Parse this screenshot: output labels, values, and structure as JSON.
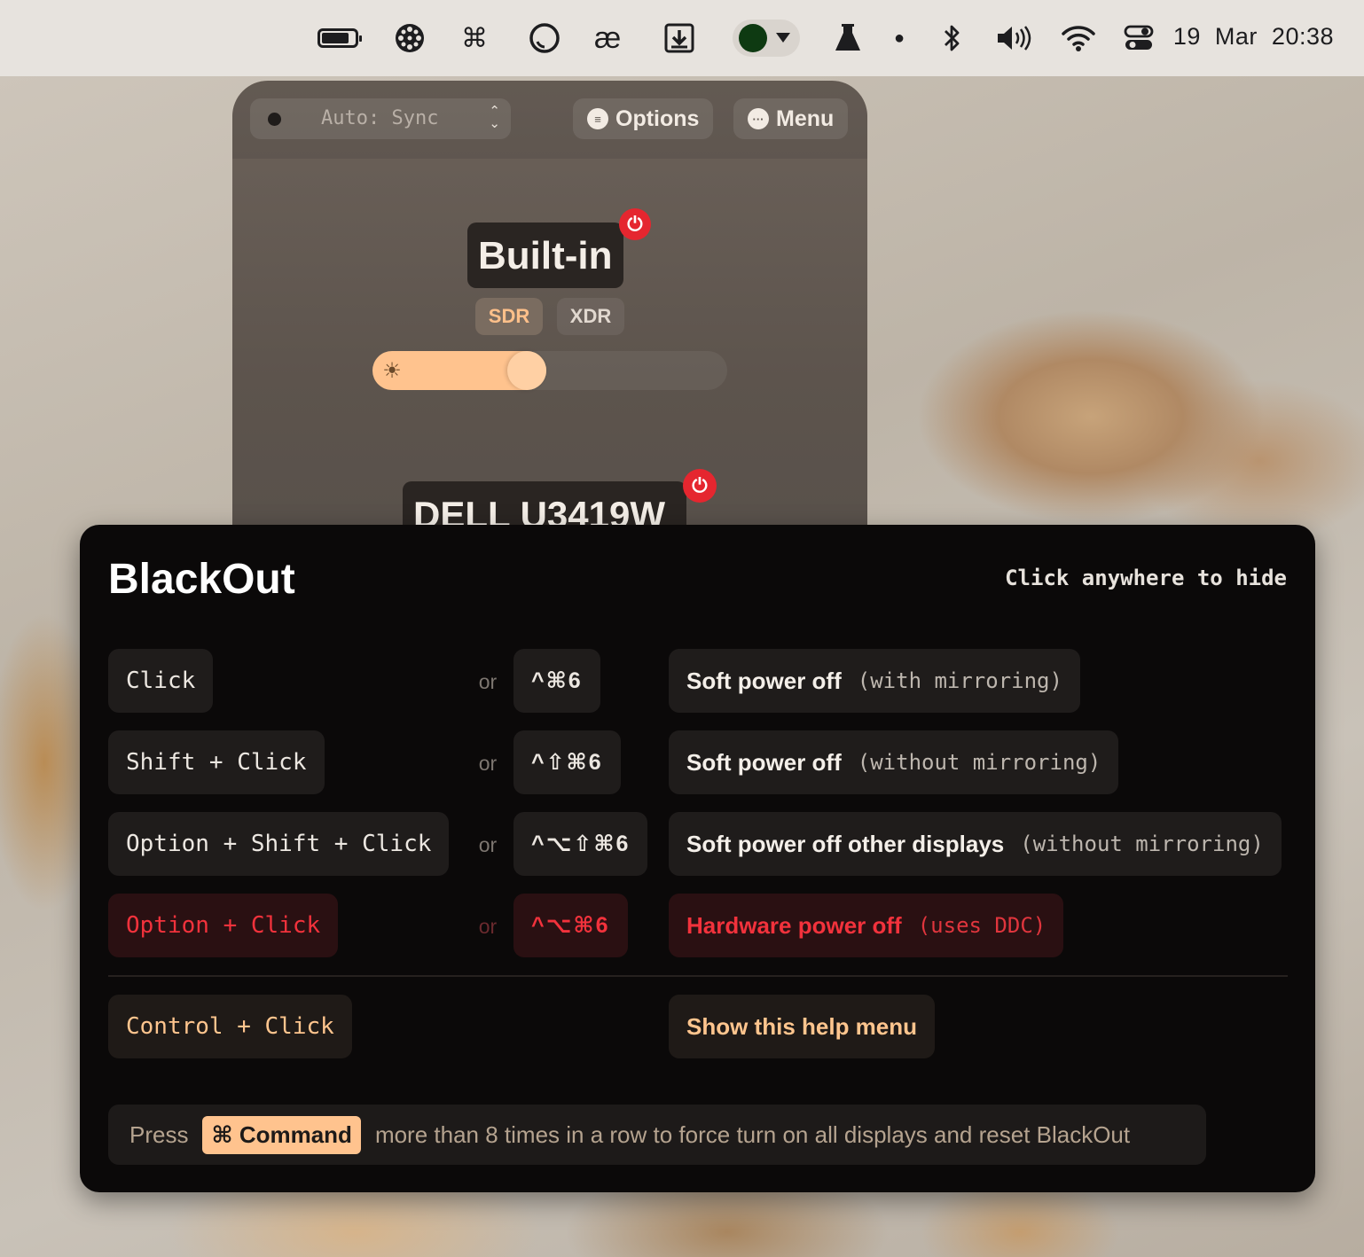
{
  "menubar": {
    "icons": [
      "battery-icon",
      "lunar-wheel-icon",
      "command-icon",
      "circle-icon",
      "ae-icon",
      "download-box-icon",
      "green-dot-dropdown-icon",
      "flask-icon",
      "dot-icon",
      "bluetooth-icon",
      "volume-icon",
      "wifi-icon",
      "control-center-icon"
    ],
    "date": "19 Mar",
    "time": "20:38"
  },
  "panel": {
    "mode_label": "Auto: Sync",
    "options_label": "Options",
    "menu_label": "Menu",
    "display1_name": "Built-in",
    "sdr_label": "SDR",
    "xdr_label": "XDR",
    "brightness": 0.49,
    "display2_name": "DELL U3419W"
  },
  "help": {
    "title": "BlackOut",
    "hint": "Click anywhere to hide",
    "or_label": "or",
    "rows": [
      {
        "trigger": "Click",
        "shortcut": "^⌘6",
        "action": "Soft power off",
        "note": "(with mirroring)"
      },
      {
        "trigger": "Shift + Click",
        "shortcut": "^⇧⌘6",
        "action": "Soft power off",
        "note": "(without mirroring)"
      },
      {
        "trigger": "Option + Shift + Click",
        "shortcut": "^⌥⇧⌘6",
        "action": "Soft power off other displays",
        "note": "(without mirroring)"
      },
      {
        "trigger": "Option + Click",
        "shortcut": "^⌥⌘6",
        "action": "Hardware power off",
        "note": "(uses DDC)"
      }
    ],
    "control_trigger": "Control + Click",
    "control_action": "Show this help menu",
    "footer_press": "Press",
    "footer_key": "⌘ Command",
    "footer_rest": "more than 8 times in a row to force turn on all displays and reset BlackOut"
  },
  "colors": {
    "accent_orange": "#ffc38e",
    "danger_red": "#f2323c",
    "power_red": "#e5262f"
  }
}
